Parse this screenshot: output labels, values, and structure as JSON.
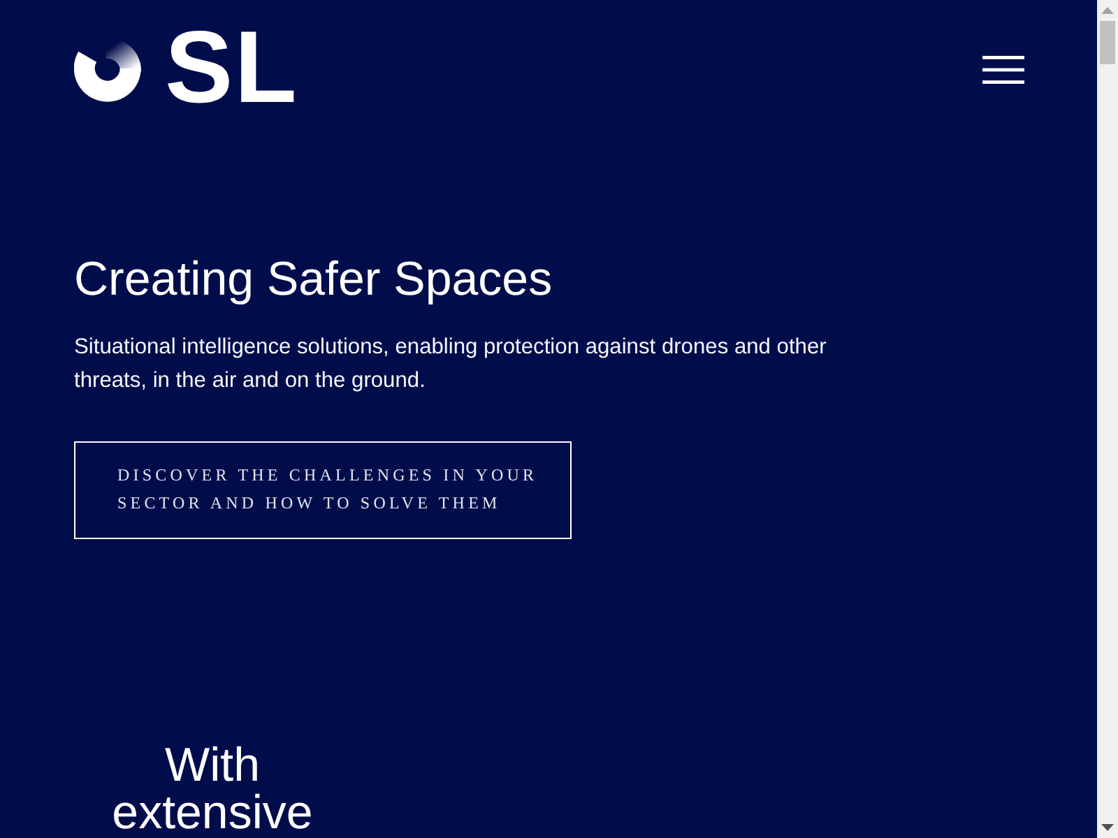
{
  "header": {
    "logo_text": "SL"
  },
  "hero": {
    "title": "Creating Safer Spaces",
    "text": "Situational intelligence solutions, enabling protection against drones and other threats, in the air and on the ground.",
    "button": "DISCOVER THE CHALLENGES IN YOUR SECTOR AND HOW TO SOLVE THEM"
  },
  "section": {
    "heading": "With extensive"
  }
}
